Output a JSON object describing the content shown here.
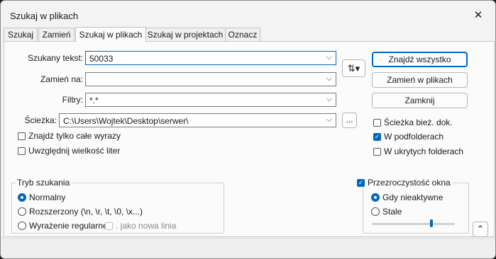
{
  "window": {
    "title": "Szukaj w plikach",
    "close_icon": "close-icon"
  },
  "tabs": [
    "Szukaj",
    "Zamień",
    "Szukaj w plikach",
    "Szukaj w projektach",
    "Oznacz"
  ],
  "fields": {
    "search_label": "Szukany tekst:",
    "search_value": "50033",
    "replace_label": "Zamień na:",
    "replace_value": "",
    "filters_label": "Filtry:",
    "filters_value": "*.*",
    "path_label": "Ścieżka:",
    "path_value": "C:\\Users\\Wojtek\\Desktop\\serwer\\",
    "browse_label": "..."
  },
  "buttons": {
    "find_all": "Znajdź wszystko",
    "replace_in_files": "Zamień w plikach",
    "close": "Zamknij"
  },
  "checkboxes": {
    "whole_words": "Znajdź tylko całe wyrazy",
    "match_case": "Uwzględnij wielkość liter",
    "current_dir": "Ścieżka bież. dok.",
    "subfolders": "W podfolderach",
    "hidden_folders": "W ukrytych folderach"
  },
  "search_mode": {
    "title": "Tryb szukania",
    "normal": "Normalny",
    "extended": "Rozszerzony (\\n, \\r, \\t, \\0, \\x...)",
    "regex": "Wyrażenie regularne",
    "dot_newline": ". jako nowa linia"
  },
  "transparency": {
    "title": "Przezroczystość okna",
    "inactive": "Gdy nieaktywne",
    "always": "Stale",
    "slider_value": 0.72
  },
  "swap_icon": "swap-arrows-icon",
  "collapse_icon": "chevron-up-icon"
}
